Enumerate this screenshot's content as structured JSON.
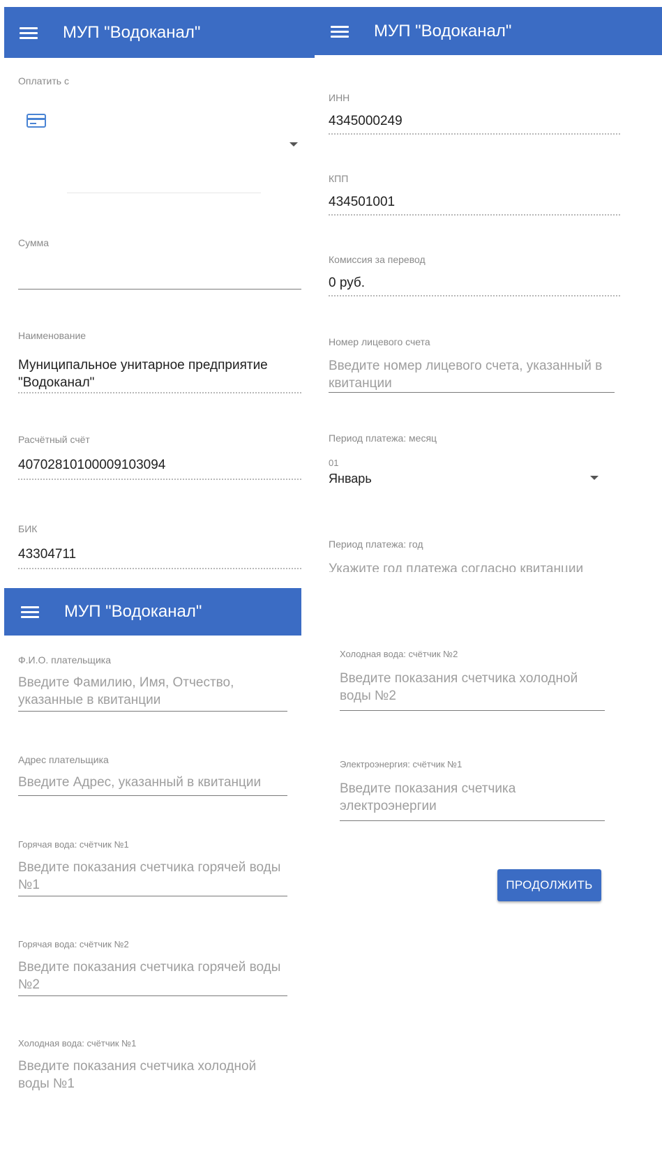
{
  "appbar": {
    "title": "МУП \"Водоканал\""
  },
  "panel1": {
    "pay_from_label": "Оплатить с",
    "amount_label": "Сумма",
    "name_label": "Наименование",
    "name_value": "Муниципальное унитарное предприятие \"Водоканал\"",
    "account_label": "Расчётный счёт",
    "account_value": "40702810100009103094",
    "bik_label": "БИК",
    "bik_value": "43304711"
  },
  "panel2": {
    "inn_label": "ИНН",
    "inn_value": "4345000249",
    "kpp_label": "КПП",
    "kpp_value": "434501001",
    "fee_label": "Комиссия за перевод",
    "fee_value": "0 руб.",
    "acc_num_label": "Номер лицевого счета",
    "acc_num_placeholder": "Введите номер лицевого счета, указанный в квитанции",
    "month_label": "Период платежа: месяц",
    "month_code": "01",
    "month_value": "Январь",
    "year_label": "Период платежа: год",
    "year_placeholder": "Укажите год платежа согласно квитанции"
  },
  "panel3": {
    "fio_label": "Ф.И.О. плательщика",
    "fio_placeholder": "Введите Фамилию, Имя, Отчество, указанные в квитанции",
    "address_label": "Адрес плательщика",
    "address_placeholder": "Введите Адрес, указанный в квитанции",
    "hot1_label": "Горячая вода: счётчик №1",
    "hot1_placeholder": "Введите показания счетчика горячей воды №1",
    "hot2_label": "Горячая вода: счётчик №2",
    "hot2_placeholder": "Введите показания счетчика горячей воды №2",
    "cold1_label": "Холодная вода: счётчик №1",
    "cold1_placeholder": "Введите показания счетчика холодной воды №1"
  },
  "panel4": {
    "cold2_label": "Холодная вода: счётчик №2",
    "cold2_placeholder": "Введите показания счетчика холодной воды №2",
    "elec_label": "Электроэнергия: счётчик №1",
    "elec_placeholder": "Введите показания счетчика электроэнергии",
    "continue_label": "ПРОДОЛЖИТЬ"
  },
  "colors": {
    "appbar": "#3b6cc4",
    "button": "#3b6cc4"
  },
  "icons": [
    "menu-icon",
    "credit-card-icon",
    "dropdown-arrow-icon"
  ]
}
